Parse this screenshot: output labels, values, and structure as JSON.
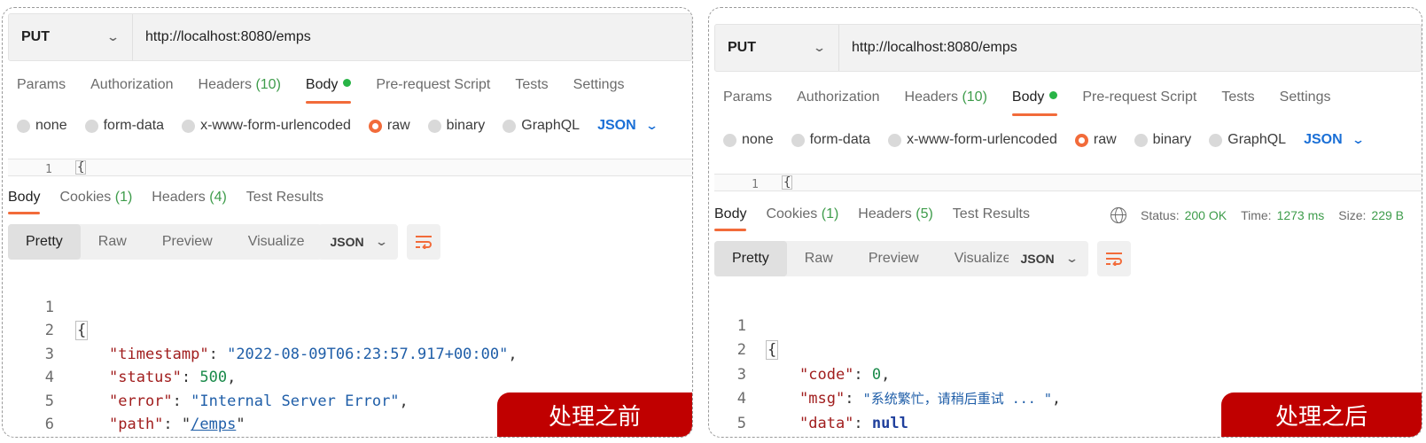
{
  "panels": [
    {
      "request": {
        "method": "PUT",
        "url": "http://localhost:8080/emps",
        "tabs": {
          "params": "Params",
          "authorization": "Authorization",
          "headers_label": "Headers",
          "headers_count": "(10)",
          "body": "Body",
          "prerequest": "Pre-request Script",
          "tests": "Tests",
          "settings": "Settings"
        },
        "body_types": {
          "none": "none",
          "form_data": "form-data",
          "urlencoded": "x-www-form-urlencoded",
          "raw": "raw",
          "binary": "binary",
          "graphql": "GraphQL",
          "format": "JSON"
        },
        "editor_line": "1",
        "editor_text": "{"
      },
      "response": {
        "tabs": {
          "body": "Body",
          "cookies_label": "Cookies",
          "cookies_count": "(1)",
          "headers_label": "Headers",
          "headers_count": "(4)",
          "test_results": "Test Results"
        },
        "views": {
          "pretty": "Pretty",
          "raw": "Raw",
          "preview": "Preview",
          "visualize": "Visualize"
        },
        "format": "JSON",
        "code": {
          "open": "{",
          "close": "}",
          "line_numbers": [
            "1",
            "2",
            "3",
            "4",
            "5",
            "6"
          ],
          "entries": [
            {
              "key": "\"timestamp\"",
              "value": "\"2022-08-09T06:23:57.917+00:00\""
            },
            {
              "key": "\"status\"",
              "value": "500"
            },
            {
              "key": "\"error\"",
              "value": "\"Internal Server Error\""
            },
            {
              "key": "\"path\"",
              "value": "/emps"
            }
          ]
        }
      },
      "badge": "处理之前"
    },
    {
      "request": {
        "method": "PUT",
        "url": "http://localhost:8080/emps",
        "tabs": {
          "params": "Params",
          "authorization": "Authorization",
          "headers_label": "Headers",
          "headers_count": "(10)",
          "body": "Body",
          "prerequest": "Pre-request Script",
          "tests": "Tests",
          "settings": "Settings"
        },
        "body_types": {
          "none": "none",
          "form_data": "form-data",
          "urlencoded": "x-www-form-urlencoded",
          "raw": "raw",
          "binary": "binary",
          "graphql": "GraphQL",
          "format": "JSON"
        },
        "editor_line": "1",
        "editor_text": "{"
      },
      "response": {
        "tabs": {
          "body": "Body",
          "cookies_label": "Cookies",
          "cookies_count": "(1)",
          "headers_label": "Headers",
          "headers_count": "(5)",
          "test_results": "Test Results"
        },
        "status": {
          "status_label": "Status:",
          "status_value": "200 OK",
          "time_label": "Time:",
          "time_value": "1273 ms",
          "size_label": "Size:",
          "size_value": "229 B"
        },
        "views": {
          "pretty": "Pretty",
          "raw": "Raw",
          "preview": "Preview",
          "visualize": "Visualize"
        },
        "format": "JSON",
        "code": {
          "open": "{",
          "close": "}",
          "line_numbers": [
            "1",
            "2",
            "3",
            "4",
            "5"
          ],
          "entries": [
            {
              "key": "\"code\"",
              "value": "0"
            },
            {
              "key": "\"msg\"",
              "value": "\"系统繁忙，请稍后重试 ... \""
            },
            {
              "key": "\"data\"",
              "value": "null"
            }
          ]
        }
      },
      "badge": "处理之后"
    }
  ]
}
